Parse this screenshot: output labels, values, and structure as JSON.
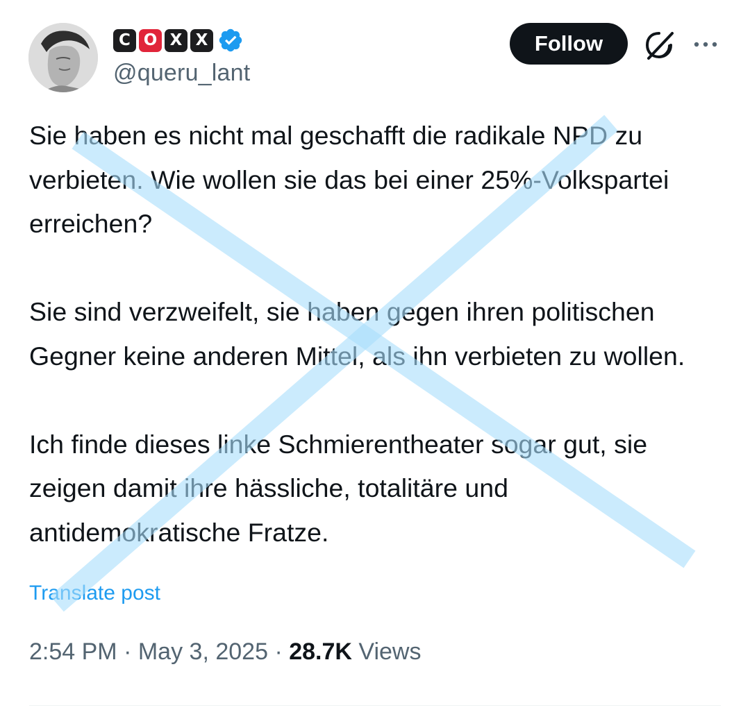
{
  "author": {
    "display_name_tiles": [
      "C",
      "O",
      "X",
      "X"
    ],
    "handle": "@queru_lant"
  },
  "header": {
    "follow_label": "Follow"
  },
  "tweet": {
    "paragraphs": [
      "Sie haben es nicht mal geschafft die radikale NPD zu verbieten. Wie wollen sie das bei einer 25%-Volkspartei erreichen?",
      "Sie sind verzweifelt, sie haben gegen ihren politischen Gegner keine anderen Mittel, als ihn verbieten zu wollen.",
      "Ich finde dieses linke Schmierentheater sogar gut, sie zeigen damit ihre hässliche, totalitäre und antidemokratische Fratze."
    ],
    "translate_label": "Translate post"
  },
  "meta": {
    "time": "2:54 PM",
    "separator": "·",
    "date": "May 3, 2025",
    "views_count": "28.7K",
    "views_label": "Views"
  },
  "colors": {
    "accent": "#1d9bf0",
    "follow_bg": "#0f1419",
    "secondary_text": "#536471",
    "name_tile_dark": "#1d1d1f",
    "name_tile_red": "#e1253a",
    "cross_overlay": "#a9ddfb"
  },
  "icons": {
    "verified": "verified-badge-icon",
    "grok": "grok-icon",
    "more": "more-horizontal-icon"
  }
}
